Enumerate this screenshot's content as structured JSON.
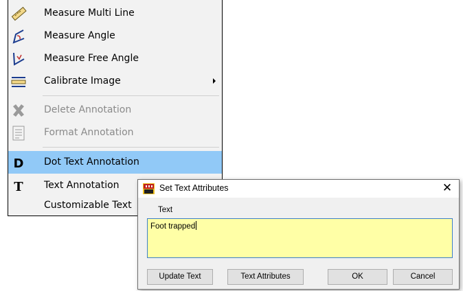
{
  "menu": {
    "items": [
      {
        "label": "Measure Multi Line",
        "icon": "ruler-icon"
      },
      {
        "label": "Measure Angle",
        "icon": "angle-icon"
      },
      {
        "label": "Measure Free Angle",
        "icon": "free-angle-icon"
      },
      {
        "label": "Calibrate Image",
        "icon": "calibrate-icon"
      },
      {
        "label": "Delete Annotation",
        "icon": "delete-icon"
      },
      {
        "label": "Format Annotation",
        "icon": "format-icon"
      },
      {
        "label": "Dot Text Annotation",
        "icon": "dot-text-icon"
      },
      {
        "label": "Text Annotation",
        "icon": "text-icon"
      },
      {
        "label": "Customizable Text",
        "icon": ""
      }
    ],
    "highlight_color": "#91c9f7",
    "disabled_color": "#8a8a8a"
  },
  "dialog": {
    "title": "Set Text Attributes",
    "close_glyph": "✕",
    "text_label": "Text",
    "text_value": "Foot trapped",
    "text_bg": "#ffffa6",
    "buttons": {
      "update_text": "Update Text",
      "text_attributes": "Text Attributes",
      "ok": "OK",
      "cancel": "Cancel"
    }
  }
}
